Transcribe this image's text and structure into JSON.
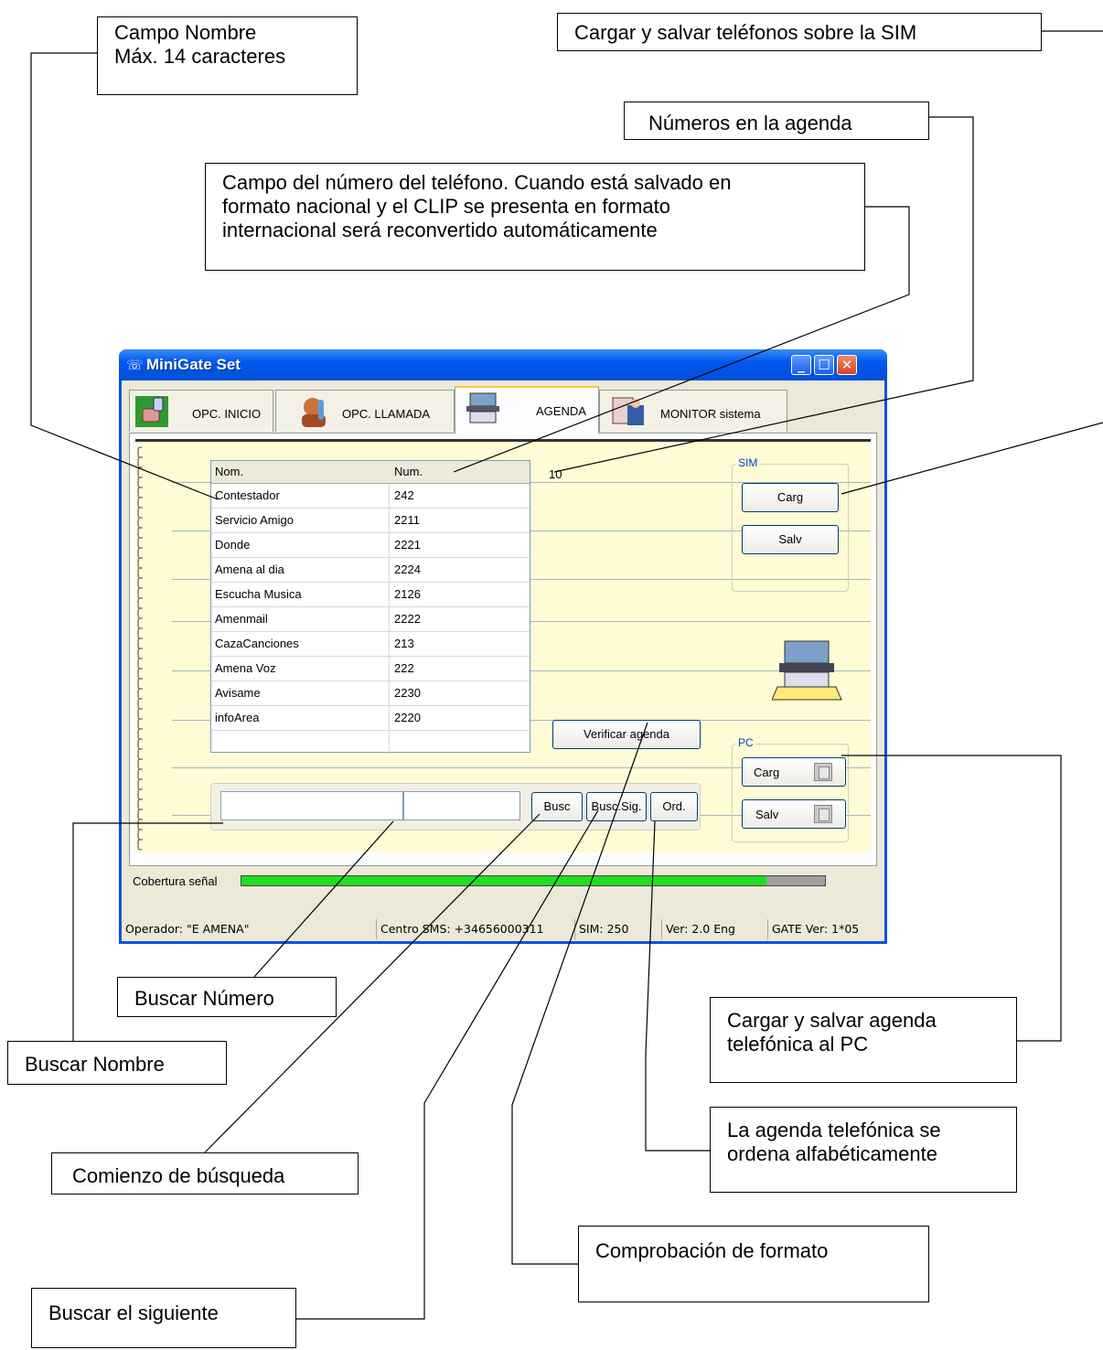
{
  "callouts": {
    "nombre_line1": "Campo Nombre",
    "nombre_line2": "Máx. 14 caracteres",
    "sim": "Cargar y salvar teléfonos sobre la SIM",
    "numeros": "Números en la agenda",
    "telefono_line1": "Campo del número del teléfono. Cuando está salvado en",
    "telefono_line2": "formato nacional y el CLIP se presenta en formato",
    "telefono_line3": "internacional será reconvertido automáticamente",
    "buscar_numero": "Buscar Número",
    "buscar_nombre": "Buscar  Nombre",
    "pc_line1": "Cargar y salvar agenda",
    "pc_line2": "telefónica al PC",
    "ordena_line1": "La agenda telefónica se",
    "ordena_line2": "ordena alfabéticamente",
    "comienzo": "Comienzo de búsqueda",
    "comprobacion": "Comprobación de formato",
    "siguiente": "Buscar el siguiente"
  },
  "window": {
    "title": "MiniGate Set",
    "tabs": [
      {
        "label": "OPC. INICIO"
      },
      {
        "label": "OPC. LLAMADA"
      },
      {
        "label": "AGENDA"
      },
      {
        "label": "MONITOR sistema"
      }
    ],
    "grid": {
      "col_name": "Nom.",
      "col_num": "Num.",
      "rows": [
        {
          "name": "Contestador",
          "num": "242"
        },
        {
          "name": "Servicio Amigo",
          "num": "2211"
        },
        {
          "name": "Donde",
          "num": "2221"
        },
        {
          "name": "Amena al dia",
          "num": "2224"
        },
        {
          "name": "Escucha Musica",
          "num": "2126"
        },
        {
          "name": "Amenmail",
          "num": "2222"
        },
        {
          "name": "CazaCanciones",
          "num": "213"
        },
        {
          "name": "Amena Voz",
          "num": "222"
        },
        {
          "name": "Avisame",
          "num": "2230"
        },
        {
          "name": "infoArea",
          "num": "2220"
        }
      ]
    },
    "count": "10",
    "sim_group": {
      "legend": "SIM",
      "load": "Carg",
      "save": "Salv"
    },
    "pc_group": {
      "legend": "PC",
      "load": "Carg",
      "save": "Salv"
    },
    "verify": "Verificar agenda",
    "search": {
      "find": "Busc",
      "find_next": "Busc.Sig.",
      "sort": "Ord."
    },
    "signal": {
      "label": "Cobertura señal",
      "level": 0.9
    },
    "status": {
      "operator": "Operador: \"E AMENA\"",
      "sms_center": "Centro SMS:  +34656000311",
      "sim": "SIM: 250",
      "ver": "Ver: 2.0  Eng",
      "gate": "GATE Ver: 1*05"
    },
    "colors": {
      "title_bar": "#0054e3",
      "signal_fill": "#22dd22",
      "paper": "#fefbd5"
    }
  }
}
